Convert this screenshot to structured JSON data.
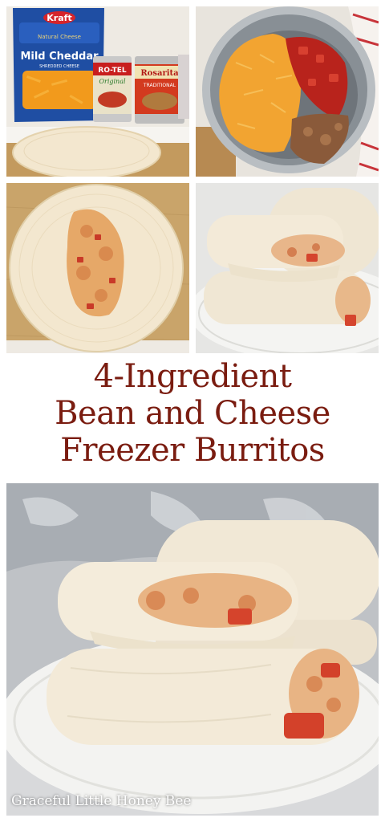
{
  "panels": {
    "ingredients": {
      "brand_logo": "Kraft",
      "bag_subtitle": "Natural Cheese",
      "bag_label": "Mild Cheddar",
      "bag_finetext": "SHREDDED CHEESE",
      "can1_brand": "RO-TEL",
      "can1_variant": "Original",
      "can2_brand": "Rosarita",
      "can2_variant": "TRADITIONAL"
    }
  },
  "title": {
    "line1": "4-Ingredient",
    "line2": "Bean and Cheese",
    "line3": "Freezer Burritos"
  },
  "watermark": "Graceful Little Honey Bee",
  "colors": {
    "title": "#7a1c10",
    "board": "#c9a46a",
    "tortilla": "#f3e7cf"
  }
}
